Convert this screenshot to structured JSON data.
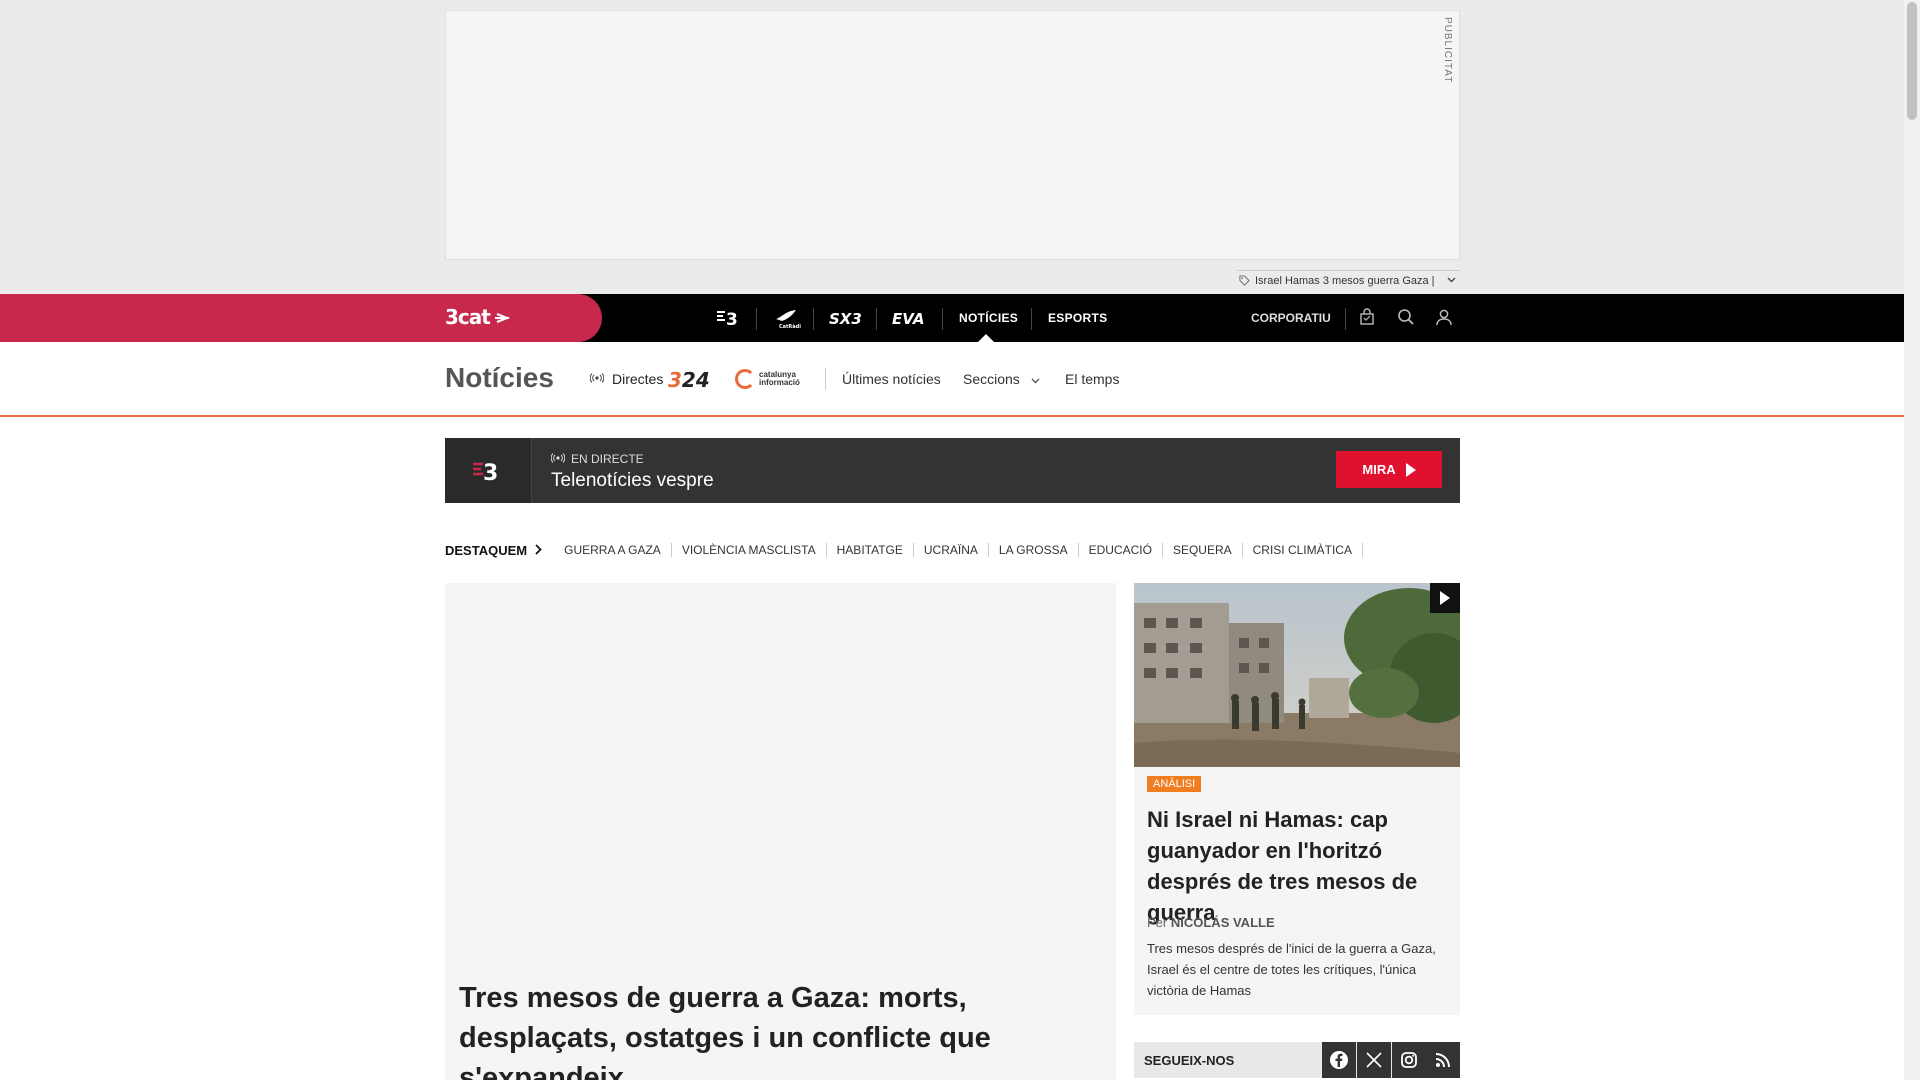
{
  "ad": {
    "label": "PUBLICITAT",
    "tags_text": "Israel Hamas 3 mesos guerra Gaza |"
  },
  "topnav": {
    "brand": "3cat",
    "channels": [
      "TV3 logo",
      "Catalunya Ràdio logo",
      "SX3 logo",
      "EVA logo"
    ],
    "links": [
      "NOTÍCIES",
      "ESPORTS"
    ],
    "active": "NOTÍCIES",
    "corporate": "CORPORATIU",
    "icons": [
      "shopping-bag-icon",
      "search-icon",
      "user-icon"
    ]
  },
  "section": {
    "title": "Notícies",
    "directes": "Directes",
    "logo_324": "324",
    "logo_catinf_line1": "catalunya",
    "logo_catinf_line2": "informació",
    "links": {
      "latest": "Últimes notícies",
      "sections": "Seccions",
      "weather": "El temps"
    }
  },
  "live": {
    "channel_logo": "3",
    "label": "EN DIRECTE",
    "title": "Telenotícies vespre",
    "button": "MIRA"
  },
  "destaquem": {
    "label": "DESTAQUEM",
    "items": [
      "GUERRA A GAZA",
      "VIOLÈNCIA MASCLISTA",
      "HABITATGE",
      "UCRAÏNA",
      "LA GROSSA",
      "EDUCACIÓ",
      "SEQUERA",
      "CRISI CLIMÀTICA"
    ]
  },
  "main_article": {
    "headline": "Tres mesos de guerra a Gaza: morts, desplaçats, ostatges i un conflicte que s'expandeix"
  },
  "side_article": {
    "tag": "ANÀLISI",
    "headline": "Ni Israel ni Hamas: cap guanyador en l'horitzó després de tres mesos de guerra",
    "byline_prefix": "Per",
    "author": "Nicolás Valle",
    "summary": "Tres mesos després de l'inici de la guerra a Gaza, Israel és el centre de totes les crítiques, l'única victòria de Hamas"
  },
  "follow": {
    "label": "SEGUEIX-NOS",
    "networks": [
      "facebook-icon",
      "x-icon",
      "instagram-icon",
      "rss-icon"
    ]
  },
  "colors": {
    "brand": "#c8284b",
    "accent_orange": "#e86b3a",
    "live_red": "#e0102f",
    "tag_orange": "#f07d20"
  }
}
